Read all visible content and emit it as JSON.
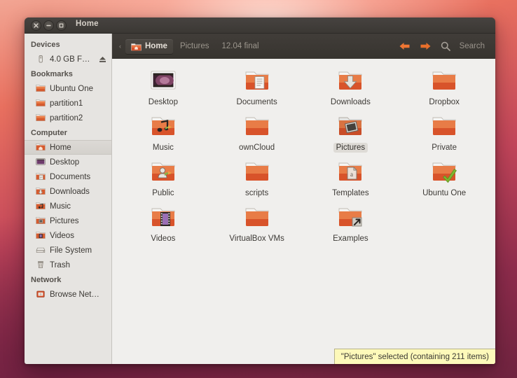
{
  "window": {
    "title": "Home",
    "controls": [
      {
        "name": "close",
        "glyph": "×"
      },
      {
        "name": "minimize",
        "glyph": "–"
      },
      {
        "name": "maximize",
        "glyph": "□"
      }
    ]
  },
  "toolbar": {
    "leading_arrow": "‹",
    "breadcrumbs": [
      {
        "label": "Home",
        "active": true,
        "icon": "home-folder-icon"
      },
      {
        "label": "Pictures",
        "active": false,
        "icon": ""
      },
      {
        "label": "12.04 final",
        "active": false,
        "icon": ""
      }
    ],
    "back_icon": "arrow-left-icon",
    "forward_icon": "arrow-right-icon",
    "search_icon": "search-icon",
    "search_label": "Search",
    "accent": "#f07633"
  },
  "sidebar": {
    "sections": [
      {
        "title": "Devices",
        "items": [
          {
            "label": "4.0 GB F…",
            "icon": "usb-drive-icon",
            "selected": false,
            "eject": true
          }
        ]
      },
      {
        "title": "Bookmarks",
        "items": [
          {
            "label": "Ubuntu One",
            "icon": "folder-icon",
            "selected": false,
            "eject": false
          },
          {
            "label": "partition1",
            "icon": "folder-icon",
            "selected": false,
            "eject": false
          },
          {
            "label": "partition2",
            "icon": "folder-icon",
            "selected": false,
            "eject": false
          }
        ]
      },
      {
        "title": "Computer",
        "items": [
          {
            "label": "Home",
            "icon": "home-icon",
            "selected": true,
            "eject": false
          },
          {
            "label": "Desktop",
            "icon": "desktop-icon",
            "selected": false,
            "eject": false
          },
          {
            "label": "Documents",
            "icon": "documents-icon",
            "selected": false,
            "eject": false
          },
          {
            "label": "Downloads",
            "icon": "downloads-icon",
            "selected": false,
            "eject": false
          },
          {
            "label": "Music",
            "icon": "music-icon",
            "selected": false,
            "eject": false
          },
          {
            "label": "Pictures",
            "icon": "pictures-icon",
            "selected": false,
            "eject": false
          },
          {
            "label": "Videos",
            "icon": "videos-icon",
            "selected": false,
            "eject": false
          },
          {
            "label": "File System",
            "icon": "harddisk-icon",
            "selected": false,
            "eject": false
          },
          {
            "label": "Trash",
            "icon": "trash-icon",
            "selected": false,
            "eject": false
          }
        ]
      },
      {
        "title": "Network",
        "items": [
          {
            "label": "Browse Net…",
            "icon": "network-icon",
            "selected": false,
            "eject": false
          }
        ]
      }
    ]
  },
  "main": {
    "items": [
      {
        "label": "Desktop",
        "icon": "desktop-wallpaper-icon",
        "selected": false
      },
      {
        "label": "Documents",
        "icon": "folder-documents-icon",
        "selected": false
      },
      {
        "label": "Downloads",
        "icon": "folder-downloads-icon",
        "selected": false
      },
      {
        "label": "Dropbox",
        "icon": "folder-icon",
        "selected": false
      },
      {
        "label": "Music",
        "icon": "folder-music-icon",
        "selected": false
      },
      {
        "label": "ownCloud",
        "icon": "folder-icon",
        "selected": false
      },
      {
        "label": "Pictures",
        "icon": "folder-pictures-icon",
        "selected": true
      },
      {
        "label": "Private",
        "icon": "folder-icon",
        "selected": false
      },
      {
        "label": "Public",
        "icon": "folder-public-icon",
        "selected": false
      },
      {
        "label": "scripts",
        "icon": "folder-icon",
        "selected": false
      },
      {
        "label": "Templates",
        "icon": "folder-templates-icon",
        "selected": false
      },
      {
        "label": "Ubuntu One",
        "icon": "folder-ubuntuone-icon",
        "selected": false
      },
      {
        "label": "Videos",
        "icon": "folder-videos-icon",
        "selected": false
      },
      {
        "label": "VirtualBox VMs",
        "icon": "folder-icon",
        "selected": false
      },
      {
        "label": "Examples",
        "icon": "folder-link-icon",
        "selected": false
      }
    ]
  },
  "statusbar": {
    "text": "\"Pictures\" selected (containing 211 items)",
    "background": "#fdf9ba"
  }
}
